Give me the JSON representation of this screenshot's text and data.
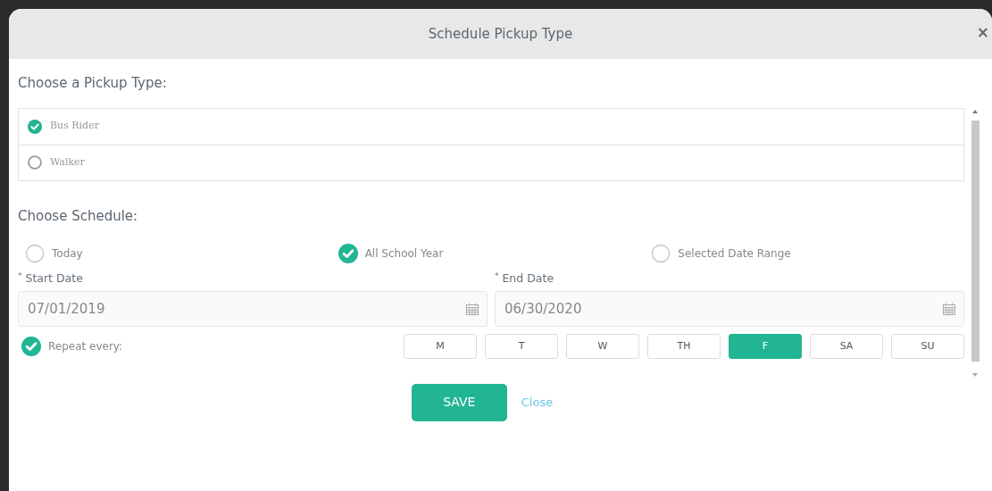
{
  "dialog": {
    "title": "Schedule Pickup Type",
    "close": "×"
  },
  "pickup_type": {
    "heading": "Choose a Pickup Type:",
    "options": [
      {
        "label": "Bus Rider",
        "selected": true
      },
      {
        "label": "Walker",
        "selected": false
      }
    ]
  },
  "schedule": {
    "heading": "Choose Schedule:",
    "options": [
      {
        "label": "Today",
        "selected": false
      },
      {
        "label": "All School Year",
        "selected": true
      },
      {
        "label": "Selected Date Range",
        "selected": false
      }
    ],
    "dates": [
      {
        "required_mark": "*",
        "label": "Start Date",
        "value": "07/01/2019"
      },
      {
        "required_mark": "*",
        "label": "End Date",
        "value": "06/30/2020"
      }
    ],
    "repeat": {
      "label": "Repeat every:",
      "checked": true
    },
    "days": [
      {
        "label": "M",
        "selected": false
      },
      {
        "label": "T",
        "selected": false
      },
      {
        "label": "W",
        "selected": false
      },
      {
        "label": "TH",
        "selected": false
      },
      {
        "label": "F",
        "selected": true
      },
      {
        "label": "SA",
        "selected": false
      },
      {
        "label": "SU",
        "selected": false
      }
    ]
  },
  "actions": {
    "save": "SAVE",
    "close": "Close"
  }
}
